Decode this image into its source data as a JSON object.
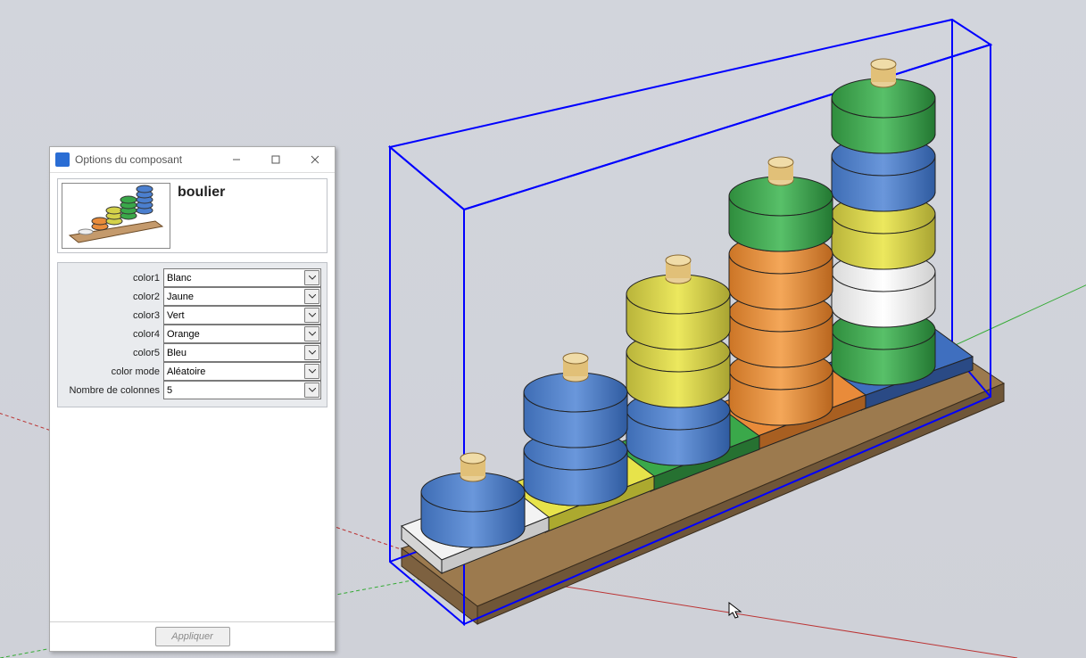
{
  "dialog": {
    "title": "Options du composant",
    "component_name": "boulier",
    "apply_label": "Appliquer",
    "fields": [
      {
        "label": "color1",
        "value": "Blanc"
      },
      {
        "label": "color2",
        "value": "Jaune"
      },
      {
        "label": "color3",
        "value": "Vert"
      },
      {
        "label": "color4",
        "value": "Orange"
      },
      {
        "label": "color5",
        "value": "Bleu"
      },
      {
        "label": "color mode",
        "value": "Aléatoire"
      },
      {
        "label": "Nombre de colonnes",
        "value": "5"
      }
    ]
  },
  "scene": {
    "selected_component": "boulier",
    "bounding_box_color": "#0000ff",
    "axes": {
      "x": "#b33",
      "y": "#3a3",
      "z": "#33b"
    },
    "columns": [
      {
        "plate": "#f0f0f0",
        "beads": [
          "#4b7fcf"
        ]
      },
      {
        "plate": "#e7e34a",
        "beads": [
          "#4b7fcf",
          "#4b7fcf"
        ]
      },
      {
        "plate": "#3aa84a",
        "beads": [
          "#4b7fcf",
          "#d4d24a",
          "#d4d24a"
        ]
      },
      {
        "plate": "#e98b3a",
        "beads": [
          "#e98b3a",
          "#e98b3a",
          "#e98b3a",
          "#3aa84a"
        ]
      },
      {
        "plate": "#4b7fcf",
        "beads": [
          "#3aa84a",
          "#ffffff",
          "#d4d24a",
          "#4b7fcf",
          "#3aa84a"
        ]
      }
    ],
    "peg_color": "#d8b46c",
    "base_color": "#9c7a4e"
  }
}
